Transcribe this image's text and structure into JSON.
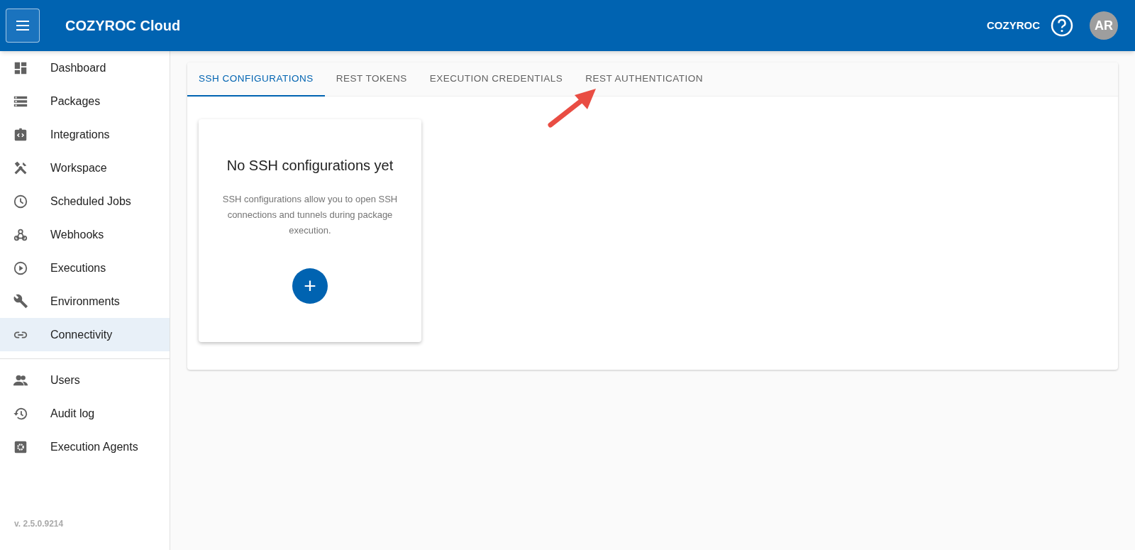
{
  "header": {
    "title": "COZYROC Cloud",
    "organization": "COZYROC",
    "avatar_initials": "AR"
  },
  "sidebar": {
    "items": [
      {
        "label": "Dashboard",
        "selected": false
      },
      {
        "label": "Packages",
        "selected": false
      },
      {
        "label": "Integrations",
        "selected": false
      },
      {
        "label": "Workspace",
        "selected": false
      },
      {
        "label": "Scheduled Jobs",
        "selected": false
      },
      {
        "label": "Webhooks",
        "selected": false
      },
      {
        "label": "Executions",
        "selected": false
      },
      {
        "label": "Environments",
        "selected": false
      },
      {
        "label": "Connectivity",
        "selected": true
      }
    ],
    "admin_items": [
      {
        "label": "Users",
        "selected": false
      },
      {
        "label": "Audit log",
        "selected": false
      },
      {
        "label": "Execution Agents",
        "selected": false
      }
    ],
    "version": "v. 2.5.0.9214"
  },
  "tabs": [
    {
      "label": "SSH CONFIGURATIONS",
      "selected": true
    },
    {
      "label": "REST TOKENS",
      "selected": false
    },
    {
      "label": "EXECUTION CREDENTIALS",
      "selected": false
    },
    {
      "label": "REST AUTHENTICATION",
      "selected": false
    }
  ],
  "empty_card": {
    "title": "No SSH configurations yet",
    "description": "SSH configurations allow you to open SSH connections and tunnels during package execution.",
    "add_button": "+"
  }
}
